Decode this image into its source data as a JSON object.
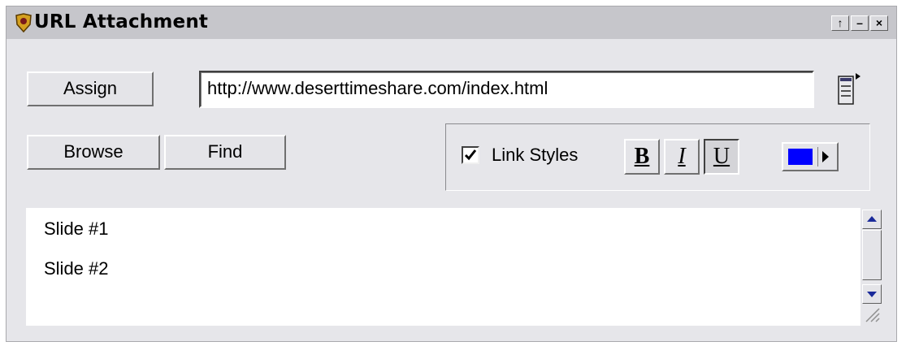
{
  "window": {
    "title": "URL Attachment",
    "title_icon": "shield-icon",
    "controls": [
      {
        "name": "restore-icon",
        "glyph": "↑"
      },
      {
        "name": "minimize-icon",
        "glyph": "–"
      },
      {
        "name": "close-icon",
        "glyph": "×"
      }
    ]
  },
  "toolbar": {
    "assign_label": "Assign",
    "browse_label": "Browse",
    "find_label": "Find",
    "url_value": "http://www.deserttimeshare.com/index.html",
    "page_menu_icon": "page-menu-icon"
  },
  "link_styles": {
    "label": "Link Styles",
    "checked": true,
    "bold_label": "B",
    "italic_label": "I",
    "underline_label": "U",
    "underline_active": true,
    "color": "#0000ff"
  },
  "slides": {
    "items": [
      "Slide #1",
      "Slide #2"
    ]
  },
  "colors": {
    "panel": "#e6e6ea",
    "titlebar": "#c6c6cb",
    "link_color": "#0000ff"
  }
}
